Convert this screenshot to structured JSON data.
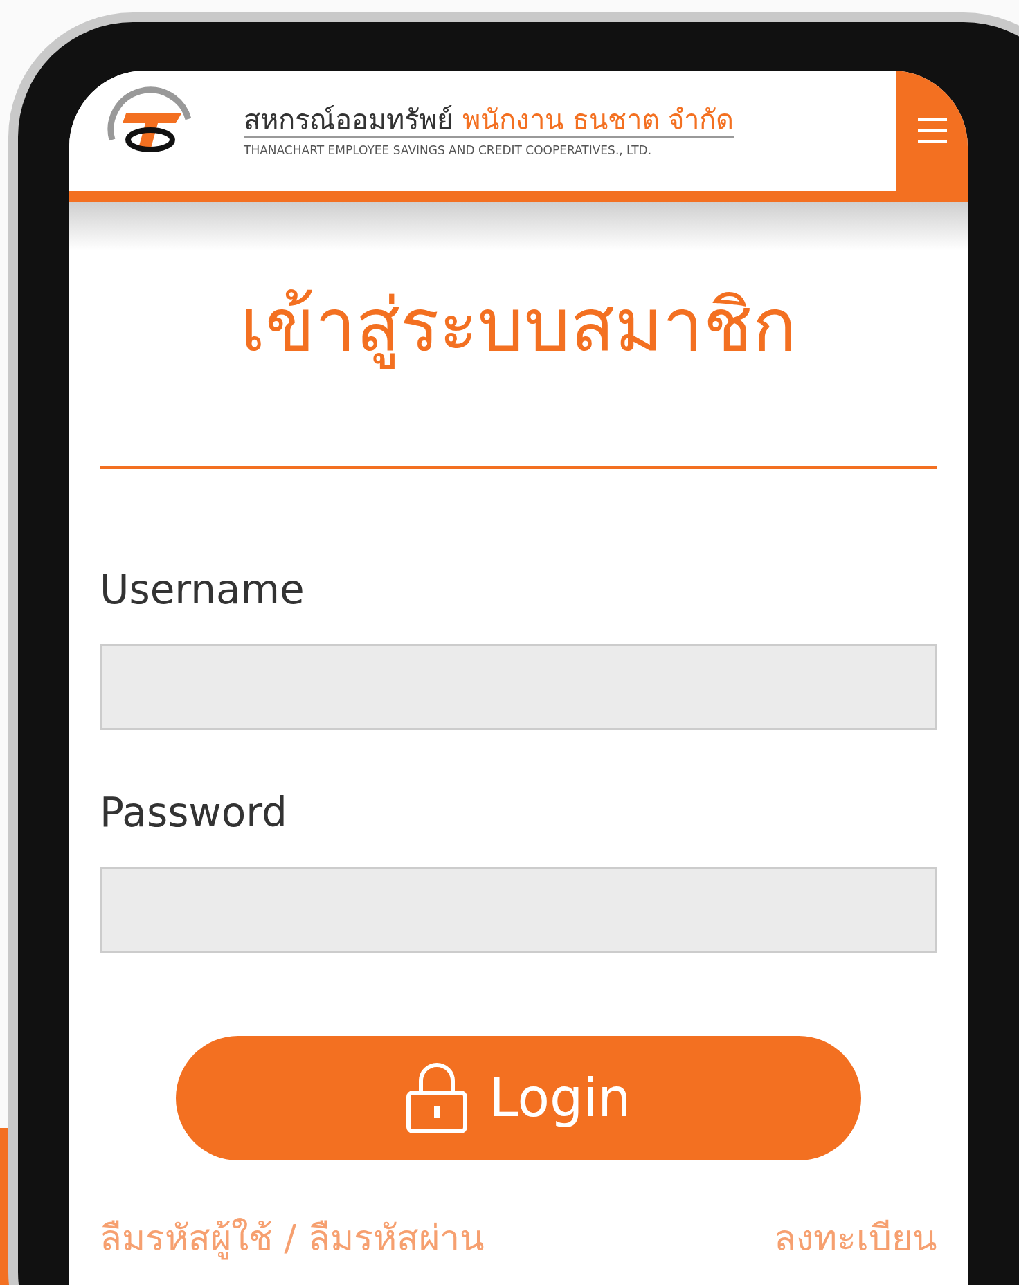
{
  "header": {
    "org_name_thai": "สหกรณ์ออมทรัพย์",
    "org_name_thai_highlight": "พนักงาน ธนชาต จำกัด",
    "org_name_english": "THANACHART EMPLOYEE SAVINGS AND CREDIT COOPERATIVES., LTD."
  },
  "title": "เข้าสู่ระบบสมาชิก",
  "fields": [
    {
      "label": "Username"
    },
    {
      "label": "Password"
    }
  ],
  "login_button": {
    "label": "Login"
  },
  "links": {
    "forgot": "ลืมรหัสผู้ใช้ / ลืมรหัสผ่าน",
    "register": "ลงทะเบียน"
  }
}
